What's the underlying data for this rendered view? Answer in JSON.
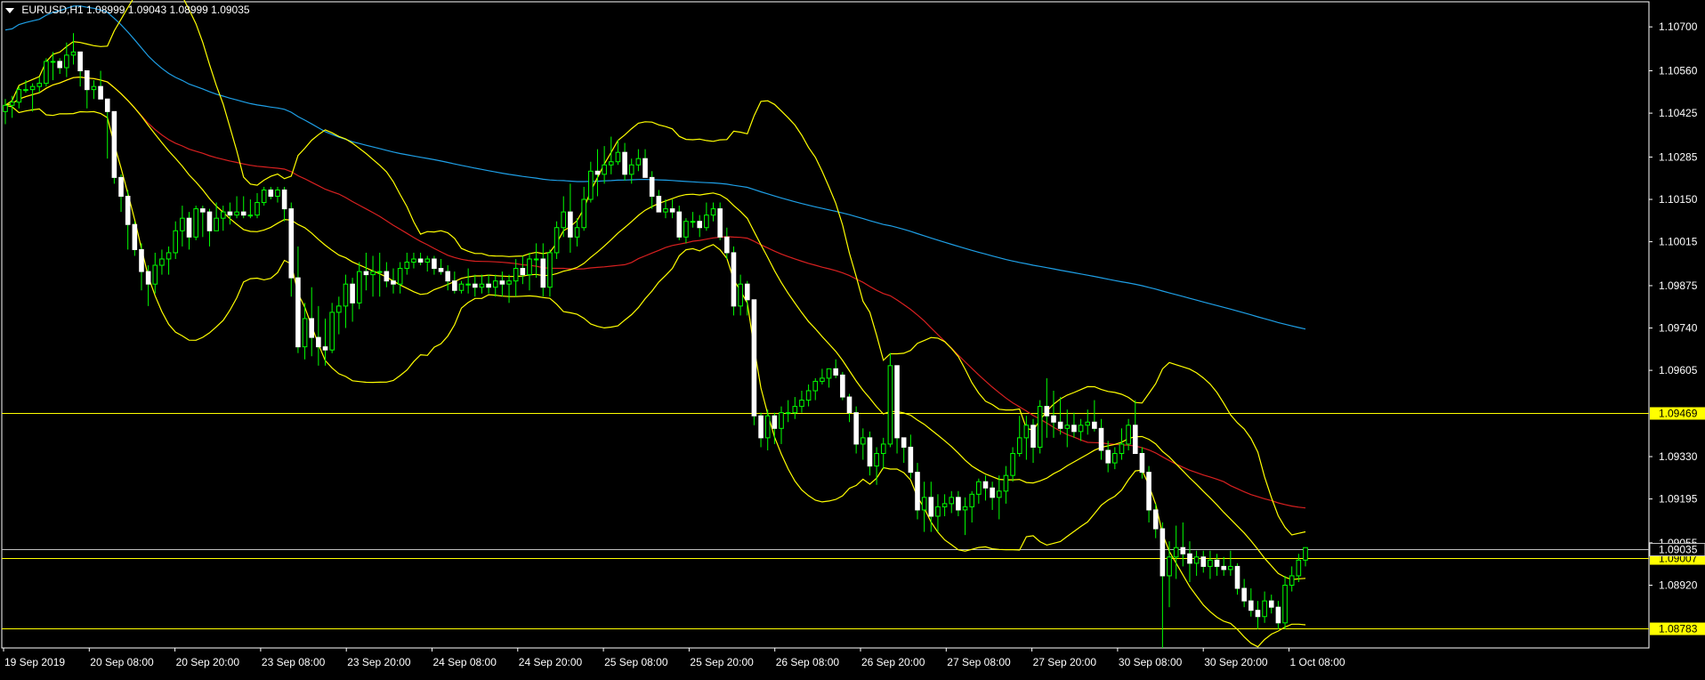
{
  "header": {
    "symbol": "EURUSD,H1",
    "ohlc": "1.08999 1.09043 1.08999 1.09035"
  },
  "chart_data": {
    "type": "candlestick",
    "symbol": "EURUSD",
    "timeframe": "H1",
    "y_ticks": [
      "1.10700",
      "1.10560",
      "1.10425",
      "1.10285",
      "1.10150",
      "1.10015",
      "1.09875",
      "1.09740",
      "1.09605",
      "1.09469",
      "1.09330",
      "1.09195",
      "1.09055",
      "1.09035",
      "1.09007",
      "1.08920",
      "1.08783"
    ],
    "ylim": [
      1.0872,
      1.1078
    ],
    "x_labels": [
      "19 Sep 2019",
      "20 Sep 08:00",
      "20 Sep 20:00",
      "23 Sep 08:00",
      "23 Sep 20:00",
      "24 Sep 08:00",
      "24 Sep 20:00",
      "25 Sep 08:00",
      "25 Sep 20:00",
      "26 Sep 08:00",
      "26 Sep 20:00",
      "27 Sep 08:00",
      "27 Sep 20:00",
      "30 Sep 08:00",
      "30 Sep 20:00",
      "1 Oct 08:00"
    ],
    "horizontal_lines": [
      {
        "value": 1.09469,
        "label": "1.09469",
        "color": "#ffff00"
      },
      {
        "value": 1.09007,
        "label": "1.09007",
        "color": "#ffff00"
      },
      {
        "value": 1.08783,
        "label": "1.08783",
        "color": "#ffff00"
      }
    ],
    "current_price": {
      "value": 1.09035,
      "label": "1.09035",
      "color": "#bfbfbf"
    },
    "candles": [
      [
        1.1043,
        1.1047,
        1.1039,
        1.1045
      ],
      [
        1.1045,
        1.1048,
        1.1041,
        1.1046
      ],
      [
        1.1046,
        1.1051,
        1.1044,
        1.105
      ],
      [
        1.105,
        1.1053,
        1.1049,
        1.105
      ],
      [
        1.105,
        1.1052,
        1.1043,
        1.1051
      ],
      [
        1.1051,
        1.1054,
        1.1049,
        1.1052
      ],
      [
        1.1052,
        1.106,
        1.1051,
        1.1059
      ],
      [
        1.1059,
        1.1062,
        1.1053,
        1.1059
      ],
      [
        1.1059,
        1.106,
        1.1055,
        1.1057
      ],
      [
        1.1057,
        1.1065,
        1.1054,
        1.1061
      ],
      [
        1.1061,
        1.1068,
        1.1058,
        1.1062
      ],
      [
        1.1062,
        1.1062,
        1.1051,
        1.1056
      ],
      [
        1.1056,
        1.1056,
        1.1044,
        1.105
      ],
      [
        1.105,
        1.1053,
        1.1047,
        1.1051
      ],
      [
        1.1051,
        1.1056,
        1.1049,
        1.1047
      ],
      [
        1.1047,
        1.1047,
        1.1028,
        1.1043
      ],
      [
        1.1043,
        1.1043,
        1.102,
        1.1022
      ],
      [
        1.1022,
        1.1023,
        1.1011,
        1.1016
      ],
      [
        1.1016,
        1.1018,
        1.0999,
        1.1007
      ],
      [
        1.1007,
        1.1008,
        1.0997,
        1.0999
      ],
      [
        1.0999,
        1.1001,
        1.0986,
        1.0992
      ],
      [
        1.0992,
        1.0994,
        1.0981,
        1.0988
      ],
      [
        1.0988,
        1.0998,
        1.0985,
        1.0994
      ],
      [
        1.0994,
        1.0999,
        1.0991,
        1.0996
      ],
      [
        1.0996,
        1.1,
        1.0991,
        1.0998
      ],
      [
        1.0998,
        1.1008,
        1.0996,
        1.1005
      ],
      [
        1.1005,
        1.1013,
        1.1,
        1.1009
      ],
      [
        1.1009,
        1.1011,
        1.0999,
        1.1003
      ],
      [
        1.1003,
        1.1013,
        1.1002,
        1.1012
      ],
      [
        1.1012,
        1.1013,
        1.1003,
        1.1011
      ],
      [
        1.1011,
        1.1012,
        1.1,
        1.1005
      ],
      [
        1.1005,
        1.1014,
        1.1005,
        1.1009
      ],
      [
        1.1009,
        1.1013,
        1.1005,
        1.1011
      ],
      [
        1.1011,
        1.1014,
        1.1007,
        1.101
      ],
      [
        1.101,
        1.1016,
        1.1009,
        1.1011
      ],
      [
        1.1011,
        1.1016,
        1.1009,
        1.101
      ],
      [
        1.101,
        1.1015,
        1.1009,
        1.101
      ],
      [
        1.101,
        1.1017,
        1.1009,
        1.1014
      ],
      [
        1.1014,
        1.1019,
        1.1013,
        1.1018
      ],
      [
        1.1018,
        1.1019,
        1.1015,
        1.1016
      ],
      [
        1.1016,
        1.1019,
        1.1014,
        1.1018
      ],
      [
        1.1018,
        1.1019,
        1.1008,
        1.1012
      ],
      [
        1.1012,
        1.1014,
        1.0984,
        1.099
      ],
      [
        1.099,
        1.1,
        1.0966,
        1.0968
      ],
      [
        1.0968,
        1.0982,
        1.0964,
        1.0977
      ],
      [
        1.0977,
        1.0987,
        1.0965,
        1.0971
      ],
      [
        1.0971,
        1.0981,
        1.0962,
        1.0968
      ],
      [
        1.0968,
        1.0977,
        1.0962,
        1.0967
      ],
      [
        1.0967,
        1.0982,
        1.0966,
        1.0979
      ],
      [
        1.0979,
        1.0984,
        1.0972,
        1.0981
      ],
      [
        1.0981,
        1.0991,
        1.0974,
        1.0988
      ],
      [
        1.0988,
        1.099,
        1.0976,
        1.0982
      ],
      [
        1.0982,
        1.0995,
        1.098,
        1.0992
      ],
      [
        1.0992,
        1.0998,
        1.0986,
        1.0991
      ],
      [
        1.0991,
        1.0997,
        1.0984,
        1.0992
      ],
      [
        1.0992,
        1.0998,
        1.0984,
        1.0992
      ],
      [
        1.0992,
        1.0995,
        1.0987,
        1.0989
      ],
      [
        1.0989,
        1.0993,
        1.0985,
        1.0988
      ],
      [
        1.0988,
        1.0995,
        1.0985,
        1.0993
      ],
      [
        1.0993,
        1.0998,
        1.0991,
        1.0995
      ],
      [
        1.0995,
        1.0998,
        1.0993,
        1.0996
      ],
      [
        1.0996,
        1.0998,
        1.0994,
        1.0995
      ],
      [
        1.0995,
        1.0997,
        1.0992,
        1.0996
      ],
      [
        1.0996,
        1.0997,
        1.0991,
        1.0993
      ],
      [
        1.0993,
        1.0996,
        1.0991,
        1.0992
      ],
      [
        1.0992,
        1.0994,
        1.0986,
        1.0989
      ],
      [
        1.0989,
        1.0992,
        1.0985,
        1.0986
      ],
      [
        1.0986,
        1.0989,
        1.0985,
        1.0988
      ],
      [
        1.0988,
        1.0993,
        1.0985,
        1.0988
      ],
      [
        1.0988,
        1.0991,
        1.0984,
        1.0987
      ],
      [
        1.0987,
        1.0991,
        1.0985,
        1.0988
      ],
      [
        1.0988,
        1.0991,
        1.0985,
        1.0987
      ],
      [
        1.0987,
        1.0991,
        1.0984,
        1.0989
      ],
      [
        1.0989,
        1.0992,
        1.0984,
        1.0988
      ],
      [
        1.0988,
        1.0991,
        1.0982,
        1.0989
      ],
      [
        1.0989,
        1.0996,
        1.0984,
        1.0993
      ],
      [
        1.0993,
        1.0997,
        1.0988,
        1.0991
      ],
      [
        1.0991,
        1.0998,
        1.0986,
        1.0996
      ],
      [
        1.0996,
        1.1001,
        1.099,
        1.0996
      ],
      [
        1.0996,
        1.1001,
        1.0984,
        1.0987
      ],
      [
        1.0987,
        1.0999,
        1.0984,
        1.0998
      ],
      [
        1.0998,
        1.1008,
        1.0996,
        1.1006
      ],
      [
        1.1006,
        1.1016,
        1.1003,
        1.1011
      ],
      [
        1.1011,
        1.102,
        1.0998,
        1.1003
      ],
      [
        1.1003,
        1.1009,
        1.1,
        1.1006
      ],
      [
        1.1006,
        1.1019,
        1.1005,
        1.1015
      ],
      [
        1.1015,
        1.1027,
        1.1014,
        1.1024
      ],
      [
        1.1024,
        1.1031,
        1.1016,
        1.1023
      ],
      [
        1.1023,
        1.1032,
        1.102,
        1.1026
      ],
      [
        1.1026,
        1.1035,
        1.1023,
        1.1027
      ],
      [
        1.1027,
        1.1034,
        1.1026,
        1.103
      ],
      [
        1.103,
        1.1033,
        1.1021,
        1.1023
      ],
      [
        1.1023,
        1.1028,
        1.102,
        1.1026
      ],
      [
        1.1026,
        1.1031,
        1.1024,
        1.1028
      ],
      [
        1.1028,
        1.1031,
        1.1022,
        1.1022
      ],
      [
        1.1022,
        1.1024,
        1.1012,
        1.1016
      ],
      [
        1.1016,
        1.1018,
        1.1011,
        1.1011
      ],
      [
        1.1011,
        1.1015,
        1.1009,
        1.1012
      ],
      [
        1.1012,
        1.1015,
        1.1009,
        1.1011
      ],
      [
        1.1011,
        1.1013,
        1.1002,
        1.1003
      ],
      [
        1.1003,
        1.1009,
        1.1001,
        1.1008
      ],
      [
        1.1008,
        1.1011,
        1.1006,
        1.1008
      ],
      [
        1.1008,
        1.101,
        1.1003,
        1.1006
      ],
      [
        1.1006,
        1.1014,
        1.1005,
        1.101
      ],
      [
        1.101,
        1.1014,
        1.1008,
        1.1012
      ],
      [
        1.1012,
        1.1014,
        1.1002,
        1.1003
      ],
      [
        1.1003,
        1.1006,
        1.0996,
        1.0998
      ],
      [
        1.0998,
        1.1,
        1.0978,
        1.0981
      ],
      [
        1.0981,
        1.0991,
        1.0978,
        1.0988
      ],
      [
        1.0988,
        1.0989,
        1.0978,
        1.0983
      ],
      [
        1.0983,
        1.0983,
        1.0943,
        1.0946
      ],
      [
        1.0946,
        1.0947,
        1.0936,
        1.0939
      ],
      [
        1.0939,
        1.0948,
        1.0935,
        1.0946
      ],
      [
        1.0946,
        1.0947,
        1.0937,
        1.0942
      ],
      [
        1.0942,
        1.0949,
        1.0937,
        1.0947
      ],
      [
        1.0947,
        1.0951,
        1.0944,
        1.0947
      ],
      [
        1.0947,
        1.0952,
        1.0945,
        1.0949
      ],
      [
        1.0949,
        1.0954,
        1.0947,
        1.0951
      ],
      [
        1.0951,
        1.0956,
        1.0949,
        1.0954
      ],
      [
        1.0954,
        1.0958,
        1.0951,
        1.0957
      ],
      [
        1.0957,
        1.0961,
        1.0956,
        1.0958
      ],
      [
        1.0958,
        1.0961,
        1.0955,
        1.0961
      ],
      [
        1.0961,
        1.0964,
        1.0958,
        1.0959
      ],
      [
        1.0959,
        1.096,
        1.0951,
        1.0952
      ],
      [
        1.0952,
        1.0953,
        1.0944,
        1.0947
      ],
      [
        1.0947,
        1.0949,
        1.0934,
        1.0937
      ],
      [
        1.0937,
        1.0942,
        1.0932,
        1.0939
      ],
      [
        1.0939,
        1.0941,
        1.0927,
        1.093
      ],
      [
        1.093,
        1.0936,
        1.0924,
        1.0934
      ],
      [
        1.0934,
        1.0939,
        1.0929,
        1.0937
      ],
      [
        1.0937,
        1.0966,
        1.0936,
        1.0962
      ],
      [
        1.0962,
        1.0962,
        1.0934,
        1.0939
      ],
      [
        1.0939,
        1.0939,
        1.0931,
        1.0936
      ],
      [
        1.0936,
        1.094,
        1.0926,
        1.0928
      ],
      [
        1.0928,
        1.0931,
        1.0913,
        1.0916
      ],
      [
        1.0916,
        1.0925,
        1.0909,
        1.092
      ],
      [
        1.092,
        1.0925,
        1.0909,
        1.0914
      ],
      [
        1.0914,
        1.0921,
        1.0909,
        1.0917
      ],
      [
        1.0917,
        1.0921,
        1.0914,
        1.0918
      ],
      [
        1.0918,
        1.0922,
        1.0915,
        1.092
      ],
      [
        1.092,
        1.0922,
        1.0914,
        1.0916
      ],
      [
        1.0916,
        1.092,
        1.0908,
        1.0917
      ],
      [
        1.0917,
        1.0922,
        1.0912,
        1.0921
      ],
      [
        1.0921,
        1.0926,
        1.0918,
        1.0925
      ],
      [
        1.0925,
        1.0927,
        1.0919,
        1.0923
      ],
      [
        1.0923,
        1.0925,
        1.0916,
        1.092
      ],
      [
        1.092,
        1.0927,
        1.0913,
        1.0922
      ],
      [
        1.0922,
        1.093,
        1.0918,
        1.0927
      ],
      [
        1.0927,
        1.0936,
        1.0925,
        1.0934
      ],
      [
        1.0934,
        1.0946,
        1.0933,
        1.0939
      ],
      [
        1.0939,
        1.0946,
        1.0932,
        1.0943
      ],
      [
        1.0943,
        1.0945,
        1.0931,
        1.0936
      ],
      [
        1.0936,
        1.0951,
        1.0934,
        1.0949
      ],
      [
        1.0949,
        1.0958,
        1.0939,
        1.0946
      ],
      [
        1.0946,
        1.0954,
        1.0939,
        1.0944
      ],
      [
        1.0944,
        1.0952,
        1.094,
        1.0942
      ],
      [
        1.0942,
        1.0948,
        1.0936,
        1.0943
      ],
      [
        1.0943,
        1.0947,
        1.0939,
        1.0941
      ],
      [
        1.0941,
        1.0945,
        1.0938,
        1.0943
      ],
      [
        1.0943,
        1.0948,
        1.094,
        1.0944
      ],
      [
        1.0944,
        1.0951,
        1.0941,
        1.0942
      ],
      [
        1.0942,
        1.0945,
        1.0932,
        1.0935
      ],
      [
        1.0935,
        1.0938,
        1.0928,
        1.0931
      ],
      [
        1.0931,
        1.0936,
        1.0929,
        1.0934
      ],
      [
        1.0934,
        1.0942,
        1.0932,
        1.0937
      ],
      [
        1.0937,
        1.0945,
        1.0935,
        1.0943
      ],
      [
        1.0943,
        1.0951,
        1.0941,
        1.0934
      ],
      [
        1.0934,
        1.0936,
        1.0926,
        1.0928
      ],
      [
        1.0928,
        1.093,
        1.0912,
        1.0916
      ],
      [
        1.0916,
        1.0918,
        1.0907,
        1.091
      ],
      [
        1.091,
        1.0912,
        1.0872,
        1.0895
      ],
      [
        1.0895,
        1.0906,
        1.0885,
        1.0901
      ],
      [
        1.0901,
        1.0911,
        1.0894,
        1.0904
      ],
      [
        1.0904,
        1.0912,
        1.0898,
        1.0902
      ],
      [
        1.0902,
        1.0906,
        1.0893,
        1.0899
      ],
      [
        1.0899,
        1.0903,
        1.0895,
        1.0901
      ],
      [
        1.0901,
        1.0903,
        1.0896,
        1.0898
      ],
      [
        1.0898,
        1.0903,
        1.0894,
        1.09
      ],
      [
        1.09,
        1.0902,
        1.0895,
        1.0898
      ],
      [
        1.0898,
        1.0901,
        1.0895,
        1.0897
      ],
      [
        1.0897,
        1.0903,
        1.0895,
        1.0898
      ],
      [
        1.0898,
        1.0899,
        1.0889,
        1.0891
      ],
      [
        1.0891,
        1.0894,
        1.0885,
        1.0887
      ],
      [
        1.0887,
        1.0891,
        1.0882,
        1.0884
      ],
      [
        1.0884,
        1.0887,
        1.0878,
        1.0882
      ],
      [
        1.0882,
        1.089,
        1.088,
        1.0887
      ],
      [
        1.0887,
        1.0889,
        1.0883,
        1.0885
      ],
      [
        1.0885,
        1.0887,
        1.0878,
        1.088
      ],
      [
        1.088,
        1.0895,
        1.0878,
        1.0892
      ],
      [
        1.0892,
        1.0898,
        1.089,
        1.0895
      ],
      [
        1.0895,
        1.0902,
        1.0893,
        1.09
      ],
      [
        1.09,
        1.0904,
        1.0898,
        1.0904
      ]
    ],
    "indicators": [
      {
        "name": "MA slow",
        "color": "#1e9fe6"
      },
      {
        "name": "MA fast",
        "color": "#d82020"
      },
      {
        "name": "Bollinger Bands",
        "color": "#ffff00"
      }
    ]
  }
}
